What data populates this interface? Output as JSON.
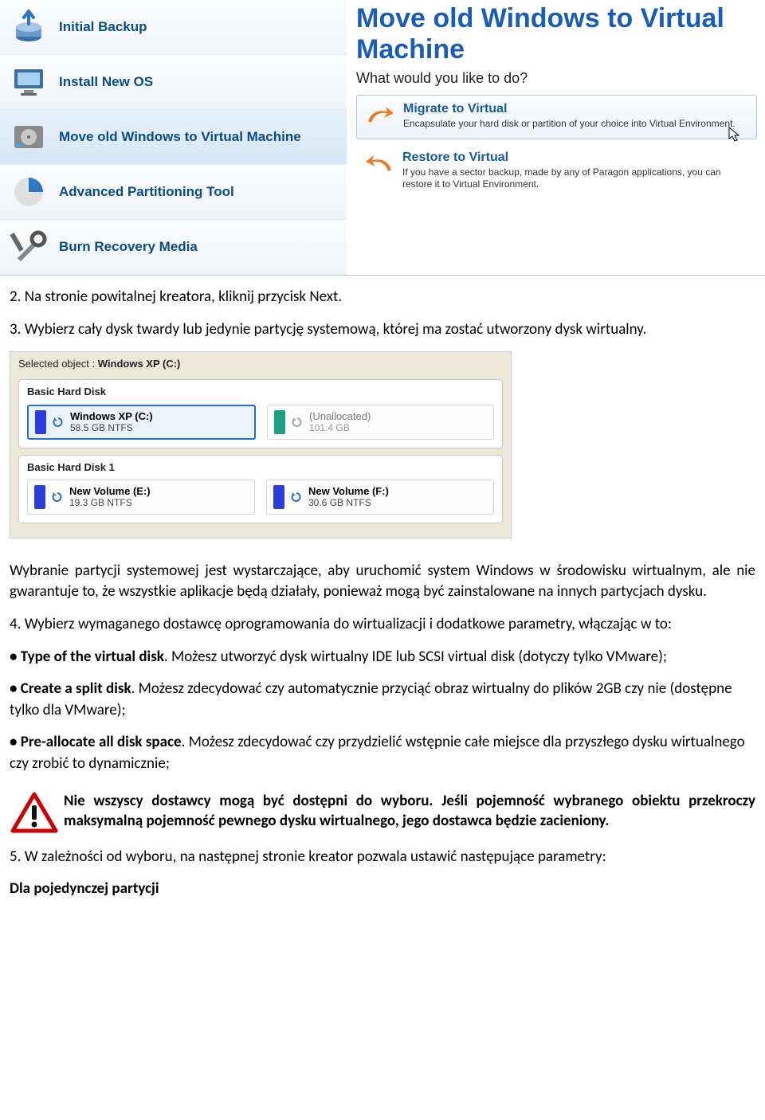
{
  "sidebar": {
    "items": [
      {
        "label": "Initial Backup"
      },
      {
        "label": "Install New OS"
      },
      {
        "label": "Move old Windows to Virtual Machine"
      },
      {
        "label": "Advanced Partitioning Tool"
      },
      {
        "label": "Burn Recovery Media"
      }
    ]
  },
  "rightPane": {
    "title": "Move old Windows to Virtual Machine",
    "subtitle": "What would you like to do?",
    "options": [
      {
        "title": "Migrate to Virtual",
        "desc": "Encapsulate your hard disk or partition of your choice into Virtual Environment."
      },
      {
        "title": "Restore to Virtual",
        "desc": "If you have a sector backup, made by any of Paragon applications, you can restore it to Virtual Environment."
      }
    ]
  },
  "disk": {
    "selectedLabel": "Selected object :",
    "selectedValue": "Windows XP (C:)",
    "groups": [
      {
        "title": "Basic Hard Disk",
        "parts": [
          {
            "name": "Windows XP (C:)",
            "sub": "58.5 GB NTFS",
            "color": "blue",
            "selected": true
          },
          {
            "name": "(Unallocated)",
            "sub": "101.4 GB",
            "color": "teal",
            "unalloc": true
          }
        ]
      },
      {
        "title": "Basic Hard Disk 1",
        "parts": [
          {
            "name": "New Volume (E:)",
            "sub": "19.3 GB NTFS",
            "color": "blue"
          },
          {
            "name": "New Volume (F:)",
            "sub": "30.6 GB NTFS",
            "color": "blue"
          }
        ]
      }
    ]
  },
  "text": {
    "p1": "2. Na stronie powitalnej kreatora, kliknij przycisk Next.",
    "p2": "3. Wybierz cały dysk twardy lub jedynie partycję systemową, której ma zostać utworzony dysk wirtualny.",
    "p3": "Wybranie partycji systemowej jest wystarczające, aby uruchomić system Windows w środowisku wirtualnym, ale nie gwarantuje to, że wszystkie aplikacje będą działały, ponieważ mogą być zainstalowane na innych partycjach dysku.",
    "p4": "4. Wybierz wymaganego dostawcę oprogramowania do wirtualizacji i dodatkowe parametry, włączając w to:",
    "p5a": "• Type of the virtual disk",
    "p5b": ". Możesz utworzyć dysk wirtualny IDE lub SCSI virtual disk (dotyczy tylko VMware);",
    "p6a": "• Create a split disk",
    "p6b": ". Możesz zdecydować czy automatycznie przyciąć obraz wirtualny do plików 2GB czy nie (dostępne tylko dla VMware);",
    "p7a": "• Pre-allocate all disk space",
    "p7b": ". Możesz zdecydować czy przydzielić wstępnie całe miejsce dla przyszłego dysku wirtualnego czy zrobić to dynamicznie;",
    "warn": "Nie wszyscy dostawcy mogą być dostępni do wyboru. Jeśli pojemność wybranego obiektu przekroczy maksymalną pojemność pewnego dysku wirtualnego, jego dostawca będzie zacieniony.",
    "p8": "5. W zależności od wyboru, na następnej stronie kreator pozwala ustawić następujące parametry:",
    "p9": "Dla pojedynczej partycji"
  }
}
